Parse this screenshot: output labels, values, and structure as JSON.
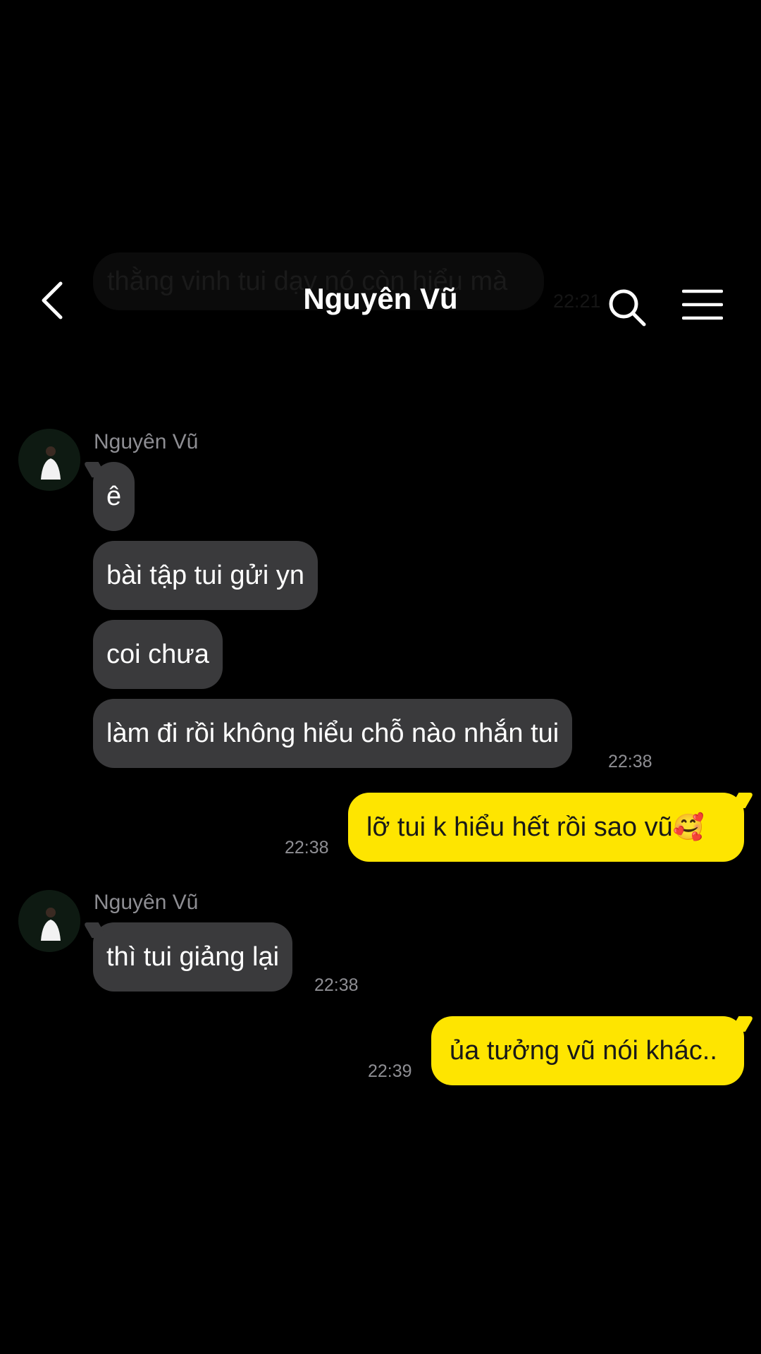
{
  "background_message": {
    "text": "thằng vinh tui dạy nó còn hiểu mà",
    "time": "22:21"
  },
  "header": {
    "title": "Nguyên Vũ",
    "back_icon": "chevron-left-icon",
    "search_icon": "search-icon",
    "menu_icon": "hamburger-menu-icon"
  },
  "colors": {
    "background": "#000000",
    "incoming_bubble": "#3a3a3c",
    "outgoing_bubble": "#fee500",
    "timestamp": "#8e8e93"
  },
  "messages": {
    "group1": {
      "sender": "Nguyên Vũ",
      "lines": [
        "ê",
        "bài tập tui gửi yn",
        "coi chưa",
        "làm đi rồi không hiểu chỗ nào nhắn tui"
      ],
      "time": "22:38"
    },
    "out1": {
      "text": "lỡ tui k hiểu hết rồi sao vũ",
      "emoji": "🥰",
      "time": "22:38"
    },
    "group2": {
      "sender": "Nguyên Vũ",
      "lines": [
        "thì tui giảng lại"
      ],
      "time": "22:38"
    },
    "out2": {
      "text": "ủa tưởng vũ nói khác..",
      "time": "22:39"
    }
  }
}
